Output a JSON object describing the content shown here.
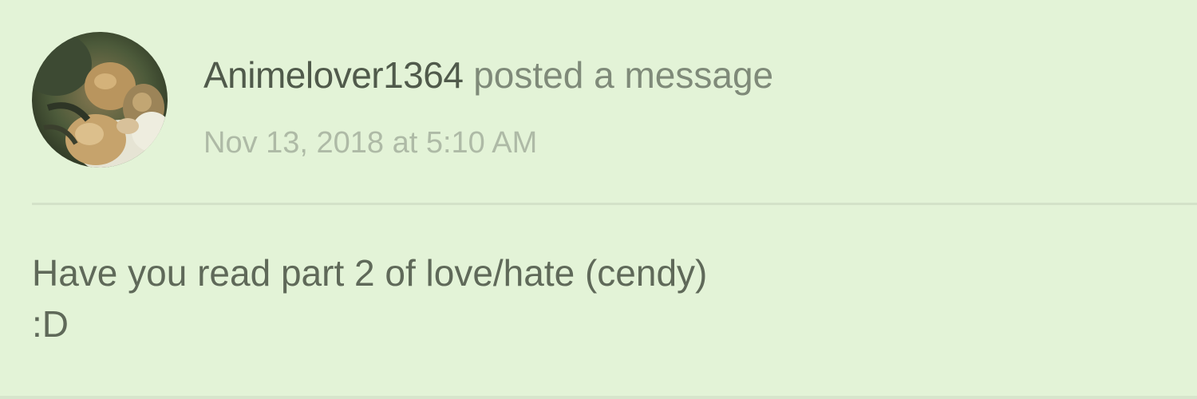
{
  "post": {
    "author": "Animelover1364",
    "action": "posted a message",
    "timestamp": "Nov 13, 2018 at 5:10 AM",
    "message_line_1": "Have you read part 2 of love/hate (cendy)",
    "message_line_2": ":D"
  },
  "colors": {
    "background": "#e3f3d7",
    "author_text": "#505a4b",
    "secondary_text": "#7f8a79",
    "timestamp_text": "#aebaa6",
    "divider": "#d3e2c8"
  },
  "icons": {
    "avatar": "user-avatar-photo"
  }
}
